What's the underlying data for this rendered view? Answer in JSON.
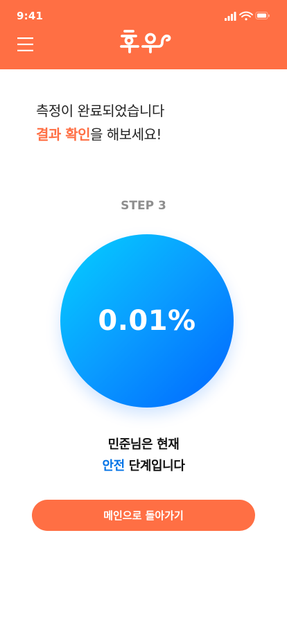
{
  "status_bar": {
    "time": "9:41"
  },
  "header": {
    "menu_icon": "hamburger-menu-icon",
    "logo": "후우"
  },
  "headline": {
    "line1": "측정이 완료되었습니다",
    "highlight": "결과 확인",
    "line2_suffix": "을 해보세요!"
  },
  "step_label": "STEP 3",
  "result": {
    "value": "0.01%"
  },
  "status_message": {
    "line1": "민준님은 현재",
    "level": "안전",
    "line2_suffix": " 단계입니다"
  },
  "main_button": {
    "label": "메인으로 돌아가기"
  },
  "colors": {
    "accent": "#FF6F44",
    "circle_gradient_start": "#04D0FF",
    "circle_gradient_end": "#0066FF",
    "safe_level": "#0072E6"
  }
}
